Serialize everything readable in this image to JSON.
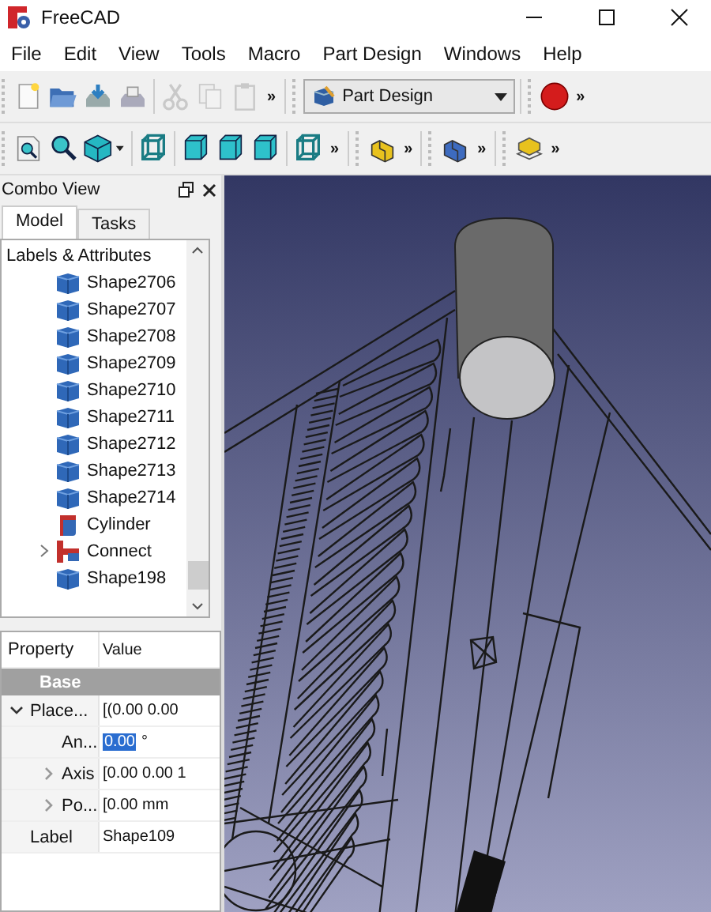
{
  "window": {
    "title": "FreeCAD"
  },
  "menu": [
    "File",
    "Edit",
    "View",
    "Tools",
    "Macro",
    "Part Design",
    "Windows",
    "Help"
  ],
  "toolbars": [
    [
      {
        "kind": "new",
        "disabled": false
      },
      {
        "kind": "open",
        "disabled": false
      },
      {
        "kind": "save",
        "disabled": false
      },
      {
        "kind": "tray",
        "disabled": false
      },
      {
        "kind": "sep"
      },
      {
        "kind": "cut",
        "disabled": true
      },
      {
        "kind": "copy",
        "disabled": true
      },
      {
        "kind": "paste",
        "disabled": true
      },
      {
        "kind": "more",
        "text": "»"
      },
      {
        "kind": "handle"
      },
      {
        "kind": "combo",
        "text": "Part Design"
      },
      {
        "kind": "handle"
      },
      {
        "kind": "record",
        "disabled": false
      },
      {
        "kind": "more",
        "text": "»"
      }
    ],
    [
      {
        "kind": "fitall",
        "disabled": false
      },
      {
        "kind": "fitsel",
        "disabled": false
      },
      {
        "kind": "iso",
        "disabled": false
      },
      {
        "kind": "sep"
      },
      {
        "kind": "front",
        "disabled": false
      },
      {
        "kind": "sep"
      },
      {
        "kind": "top",
        "disabled": false
      },
      {
        "kind": "right",
        "disabled": false
      },
      {
        "kind": "rear",
        "disabled": false
      },
      {
        "kind": "sep"
      },
      {
        "kind": "left",
        "disabled": false
      },
      {
        "kind": "more",
        "text": "»"
      },
      {
        "kind": "handle"
      },
      {
        "kind": "part",
        "disabled": false
      },
      {
        "kind": "more",
        "text": "»"
      },
      {
        "kind": "handle"
      },
      {
        "kind": "body",
        "disabled": false
      },
      {
        "kind": "more",
        "text": "»"
      },
      {
        "kind": "handle"
      },
      {
        "kind": "plane",
        "disabled": false
      },
      {
        "kind": "more",
        "text": "»"
      }
    ]
  ],
  "combo_view": {
    "title": "Combo View",
    "tabs": [
      {
        "label": "Model",
        "selected": true
      },
      {
        "label": "Tasks",
        "selected": false
      }
    ],
    "tree": {
      "header": "Labels & Attributes",
      "items": [
        {
          "label": "Shape2706",
          "kind": "shape",
          "expandable": false
        },
        {
          "label": "Shape2707",
          "kind": "shape",
          "expandable": false
        },
        {
          "label": "Shape2708",
          "kind": "shape",
          "expandable": false
        },
        {
          "label": "Shape2709",
          "kind": "shape",
          "expandable": false
        },
        {
          "label": "Shape2710",
          "kind": "shape",
          "expandable": false
        },
        {
          "label": "Shape2711",
          "kind": "shape",
          "expandable": false
        },
        {
          "label": "Shape2712",
          "kind": "shape",
          "expandable": false
        },
        {
          "label": "Shape2713",
          "kind": "shape",
          "expandable": false
        },
        {
          "label": "Shape2714",
          "kind": "shape",
          "expandable": false
        },
        {
          "label": "Cylinder",
          "kind": "cylinder",
          "expandable": false
        },
        {
          "label": "Connect",
          "kind": "connect",
          "expandable": true
        },
        {
          "label": "Shape198",
          "kind": "shape",
          "expandable": false
        }
      ]
    },
    "properties": {
      "columns": [
        "Property",
        "Value"
      ],
      "group": "Base",
      "rows": [
        {
          "name": "Place...",
          "value": "[(0.00 0.00",
          "expanded": true,
          "children": [
            {
              "name": "An...",
              "value": "0.00",
              "unit": "°",
              "editing": true
            },
            {
              "name": "Axis",
              "value": "[0.00 0.00 1",
              "expanded": false,
              "editing": false
            },
            {
              "name": "Po...",
              "value": "[0.00 mm",
              "expanded": false,
              "editing": false
            }
          ],
          "editing": false
        },
        {
          "name": "Label",
          "value": "Shape109",
          "editing": false
        }
      ]
    }
  }
}
